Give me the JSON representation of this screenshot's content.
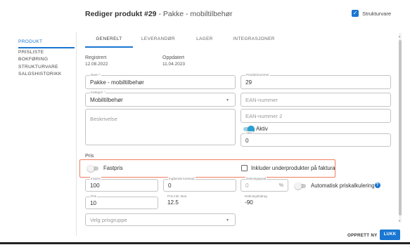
{
  "header": {
    "title_main": "Rediger produkt #29",
    "title_separator": " - ",
    "title_sub": "Pakke - mobiltilbehør",
    "structure_label": "Strukturvare",
    "structure_checked": true
  },
  "sidebar": {
    "items": [
      {
        "label": "PRODUKT",
        "active": true
      },
      {
        "label": "PRISLISTE",
        "active": false
      },
      {
        "label": "BOKFØRING",
        "active": false
      },
      {
        "label": "STRUKTURVARE",
        "active": false
      },
      {
        "label": "SALGSHISTORIKK",
        "active": false
      }
    ]
  },
  "tabs": [
    {
      "label": "GENERELT",
      "active": true
    },
    {
      "label": "LEVERANDØR",
      "active": false
    },
    {
      "label": "LAGER",
      "active": false
    },
    {
      "label": "INTEGRASJONER",
      "active": false
    }
  ],
  "meta": {
    "registered_label": "Registrert",
    "registered_value": "12.08.2022",
    "updated_label": "Oppdatert",
    "updated_value": "11.04.2023"
  },
  "form": {
    "name": {
      "label": "Navn *",
      "value": "Pakke - mobiltilbehør"
    },
    "product_number": {
      "label": "Produktnummer",
      "value": "29"
    },
    "category": {
      "label": "Kategori *",
      "value": "Mobiltilbehør"
    },
    "ean": {
      "placeholder": "EAN-nummer"
    },
    "description": {
      "placeholder": "Beskrivelse"
    },
    "ean2": {
      "placeholder": "EAN-nummer 2"
    },
    "active": {
      "label": "Aktiv",
      "on": true
    },
    "weight": {
      "label": "Vekt",
      "value": "0"
    }
  },
  "price": {
    "section_label": "Pris",
    "fixed_price": {
      "label": "Fastpris",
      "on": false
    },
    "include_subproducts": {
      "label": "Inkluder underprodukter på faktura",
      "checked": false
    },
    "purchase_price": {
      "label": "Innpris",
      "value": "100"
    },
    "extra_cost": {
      "label": "Ingående kostnad",
      "value": "0"
    },
    "coverage_rate": {
      "label": "Dekningsgrad",
      "value": "0",
      "unit": "%"
    },
    "auto_calc": {
      "label": "Automatisk priskalkulering",
      "on": false,
      "help": "?"
    },
    "price": {
      "label": "Pris",
      "value": "10"
    },
    "price_incl_vat": {
      "label": "Pris inkl. Mva",
      "value": "12.5"
    },
    "coverage_amount": {
      "label": "Dekningsbidrag",
      "value": "-90"
    },
    "price_group": {
      "placeholder": "Velg prisgruppe"
    }
  },
  "footer": {
    "create_new": "OPPRETT NY",
    "close": "LUKK"
  },
  "icons": {
    "check": "✓",
    "dropdown": "▼",
    "scroll_up": "▲",
    "scroll_down": "▼"
  },
  "colors": {
    "accent": "#1976d2",
    "highlight": "#f07e5f",
    "toggle_on": "#2a9fd1"
  }
}
